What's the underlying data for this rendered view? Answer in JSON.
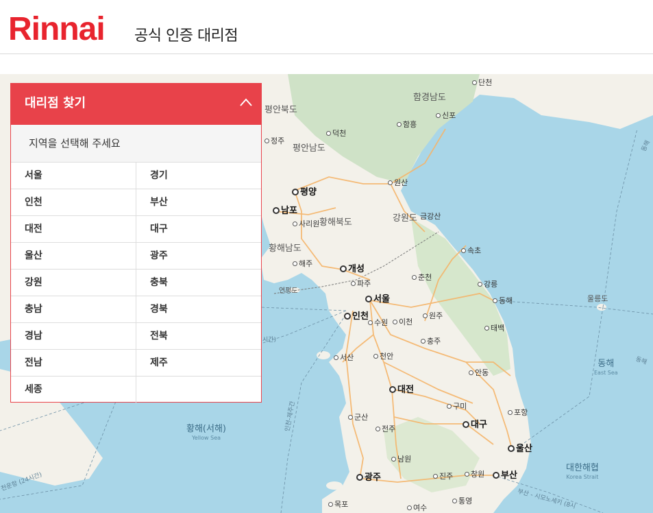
{
  "header": {
    "brand": "Rinnai",
    "subtitle": "공식 인증 대리점"
  },
  "colors": {
    "brand_red": "#e8242e",
    "panel_red": "#e8424a",
    "sea": "#a9d6e8",
    "land": "#f4f2ec",
    "roads": "#f5b56a"
  },
  "panel": {
    "title": "대리점 찾기",
    "toggle_icon": "chevron-up-icon",
    "select_prompt": "지역을 선택해 주세요",
    "regions": [
      "서울",
      "경기",
      "인천",
      "부산",
      "대전",
      "대구",
      "울산",
      "광주",
      "강원",
      "충북",
      "충남",
      "경북",
      "경남",
      "전북",
      "전남",
      "제주",
      "세종"
    ]
  },
  "map": {
    "places": [
      {
        "name": "단천",
        "kind": "city"
      },
      {
        "name": "함경남도",
        "kind": "region"
      },
      {
        "name": "신포",
        "kind": "city"
      },
      {
        "name": "평안북도",
        "kind": "region"
      },
      {
        "name": "함흥",
        "kind": "city"
      },
      {
        "name": "덕천",
        "kind": "city"
      },
      {
        "name": "정주",
        "kind": "city"
      },
      {
        "name": "평안남도",
        "kind": "region"
      },
      {
        "name": "원산",
        "kind": "city"
      },
      {
        "name": "평양",
        "kind": "major"
      },
      {
        "name": "남포",
        "kind": "major"
      },
      {
        "name": "강원도",
        "kind": "region"
      },
      {
        "name": "금강산",
        "kind": "region"
      },
      {
        "name": "사리원",
        "kind": "city"
      },
      {
        "name": "황해북도",
        "kind": "region"
      },
      {
        "name": "황해남도",
        "kind": "region"
      },
      {
        "name": "속초",
        "kind": "city"
      },
      {
        "name": "해주",
        "kind": "city"
      },
      {
        "name": "개성",
        "kind": "major"
      },
      {
        "name": "춘천",
        "kind": "city"
      },
      {
        "name": "파주",
        "kind": "city"
      },
      {
        "name": "강릉",
        "kind": "city"
      },
      {
        "name": "연평도",
        "kind": "region"
      },
      {
        "name": "서울",
        "kind": "major"
      },
      {
        "name": "동해",
        "kind": "city"
      },
      {
        "name": "울릉도",
        "kind": "region"
      },
      {
        "name": "인천",
        "kind": "major"
      },
      {
        "name": "원주",
        "kind": "city"
      },
      {
        "name": "수원",
        "kind": "city"
      },
      {
        "name": "이천",
        "kind": "city"
      },
      {
        "name": "태백",
        "kind": "city"
      },
      {
        "name": "충주",
        "kind": "city"
      },
      {
        "name": "서산",
        "kind": "city"
      },
      {
        "name": "천안",
        "kind": "city"
      },
      {
        "name": "안동",
        "kind": "city"
      },
      {
        "name": "대전",
        "kind": "major"
      },
      {
        "name": "구미",
        "kind": "city"
      },
      {
        "name": "포항",
        "kind": "city"
      },
      {
        "name": "군산",
        "kind": "city"
      },
      {
        "name": "대구",
        "kind": "major"
      },
      {
        "name": "전주",
        "kind": "city"
      },
      {
        "name": "울산",
        "kind": "major"
      },
      {
        "name": "남원",
        "kind": "city"
      },
      {
        "name": "광주",
        "kind": "major"
      },
      {
        "name": "진주",
        "kind": "city"
      },
      {
        "name": "창원",
        "kind": "city"
      },
      {
        "name": "부산",
        "kind": "major"
      },
      {
        "name": "통영",
        "kind": "city"
      },
      {
        "name": "목포",
        "kind": "city"
      },
      {
        "name": "여수",
        "kind": "city"
      }
    ],
    "seas": [
      {
        "name": "동해",
        "en": "East Sea"
      },
      {
        "name": "황해(서해)",
        "en": "Yellow Sea"
      },
      {
        "name": "대한해협",
        "en": "Korea Strait"
      }
    ],
    "routes": [
      "인천-제주간",
      "부산 - 시모노세키 (8시",
      "천운항 (24시간)",
      "시간)",
      "동해",
      "동해"
    ]
  }
}
